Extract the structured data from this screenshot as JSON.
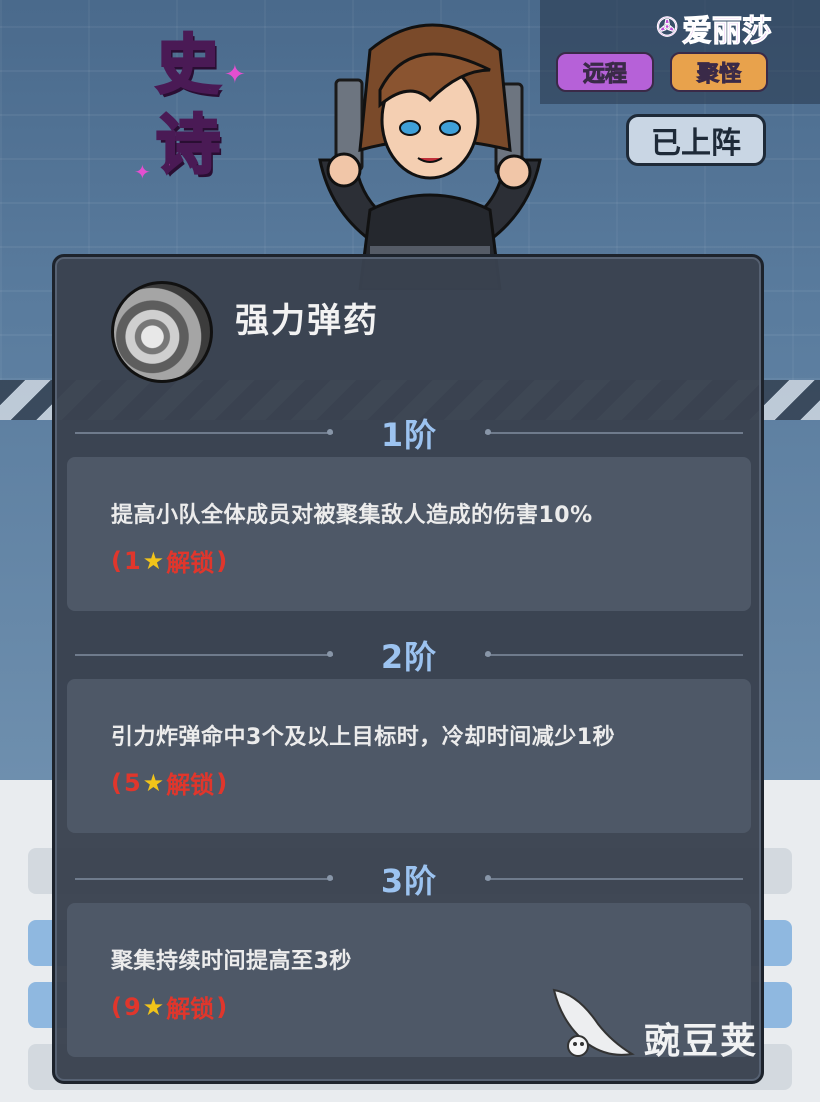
{
  "rarity": {
    "char1": "史",
    "char2": "诗"
  },
  "hero": {
    "name": "爱丽莎",
    "tags": [
      "远程",
      "聚怪"
    ],
    "deploy_button": "已上阵"
  },
  "skill": {
    "title": "强力弹药",
    "icon": "bullet-cartridge-icon",
    "tiers": [
      {
        "label": "1阶",
        "description": "提高小队全体成员对被聚集敌人造成的伤害10%",
        "open": "(",
        "stars": "1",
        "unlock_text": "解锁",
        "close": ")"
      },
      {
        "label": "2阶",
        "description": "引力炸弹命中3个及以上目标时，冷却时间减少1秒",
        "open": "(",
        "stars": "5",
        "unlock_text": "解锁",
        "close": ")"
      },
      {
        "label": "3阶",
        "description": "聚集持续时间提高至3秒",
        "open": "(",
        "stars": "9",
        "unlock_text": "解锁",
        "close": ")"
      }
    ]
  },
  "watermark": {
    "text": "豌豆荚",
    "logo": "pea-pod-logo"
  },
  "colors": {
    "rarity_purple": "#e44fd0",
    "tier_blue": "#9cc3f0",
    "unlock_red": "#e0362c",
    "star_gold": "#f2c41a"
  }
}
